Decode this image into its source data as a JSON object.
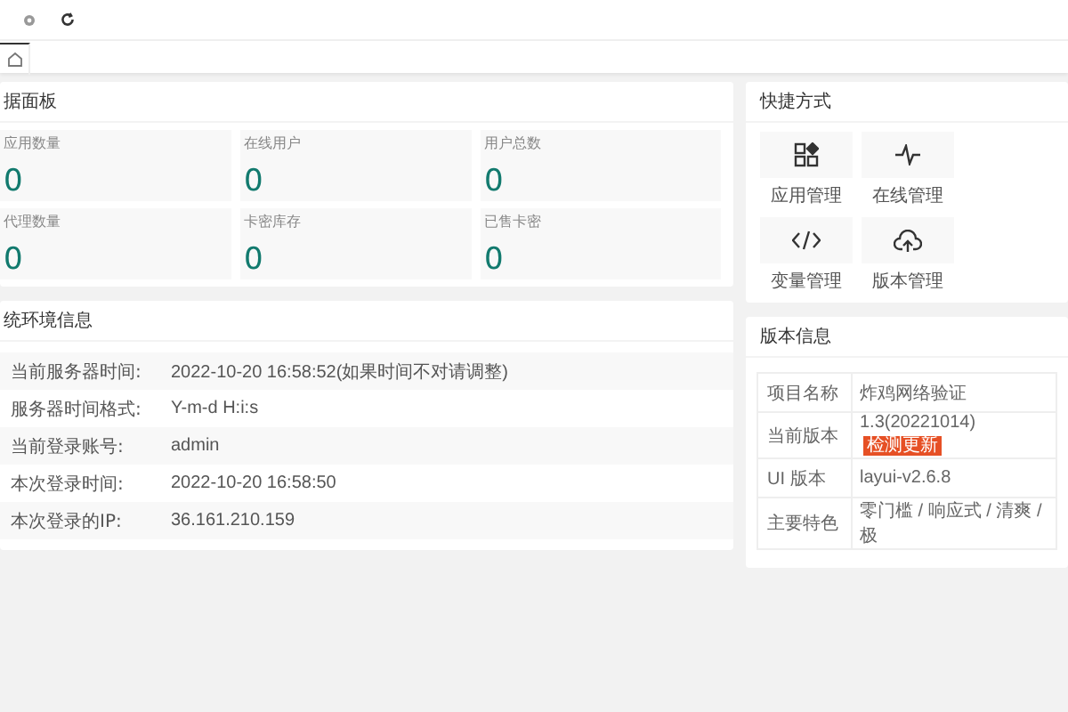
{
  "dashboard": {
    "title": "据面板",
    "stats": [
      {
        "label": "应用数量",
        "value": "0"
      },
      {
        "label": "在线用户",
        "value": "0"
      },
      {
        "label": "用户总数",
        "value": "0"
      },
      {
        "label": "代理数量",
        "value": "0"
      },
      {
        "label": "卡密库存",
        "value": "0"
      },
      {
        "label": "已售卡密",
        "value": "0"
      }
    ]
  },
  "quick_links": {
    "title": "快捷方式",
    "items": [
      {
        "label": "应用管理",
        "kind": "apps"
      },
      {
        "label": "在线管理",
        "kind": "pulse"
      },
      {
        "label": "变量管理",
        "kind": "code"
      },
      {
        "label": "版本管理",
        "kind": "cloud"
      }
    ]
  },
  "system_info": {
    "title": "统环境信息",
    "rows": [
      {
        "label": "当前服务器时间:",
        "value": "2022-10-20 16:58:52(如果时间不对请调整)"
      },
      {
        "label": "服务器时间格式:",
        "value": "Y-m-d H:i:s"
      },
      {
        "label": "当前登录账号:",
        "value": "admin"
      },
      {
        "label": "本次登录时间:",
        "value": "2022-10-20 16:58:50"
      },
      {
        "label": "本次登录的IP:",
        "value": "36.161.210.159"
      }
    ]
  },
  "version_info": {
    "title": "版本信息",
    "rows": [
      {
        "label": "项目名称",
        "value": "炸鸡网络验证"
      },
      {
        "label": "当前版本",
        "value": "1.3(20221014)",
        "badge": "检测更新"
      },
      {
        "label": "UI 版本",
        "value": "layui-v2.6.8"
      },
      {
        "label": "主要特色",
        "value": "零门槛 / 响应式 / 清爽 / 极"
      }
    ]
  }
}
